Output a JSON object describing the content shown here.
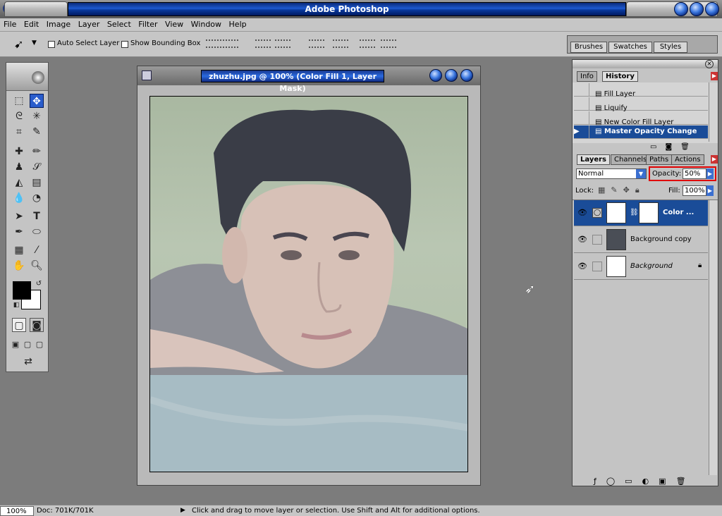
{
  "window": {
    "title": "Adobe Photoshop"
  },
  "menu": [
    "File",
    "Edit",
    "Image",
    "Layer",
    "Select",
    "Filter",
    "View",
    "Window",
    "Help"
  ],
  "options": {
    "auto_select_layer": "Auto Select Layer",
    "show_bounding_box": "Show Bounding Box"
  },
  "palette_well": {
    "tabs": [
      "Brushes",
      "Swatches",
      "Styles"
    ]
  },
  "document": {
    "title": "zhuzhu.jpg @ 100% (Color Fill 1, Layer Mask)"
  },
  "history_panel": {
    "tabs": [
      "Info",
      "History"
    ],
    "items": [
      "Fill Layer",
      "Liquify",
      "New Color Fill Layer",
      "Master Opacity Change"
    ]
  },
  "layers_panel": {
    "tabs": [
      "Layers",
      "Channels",
      "Paths",
      "Actions"
    ],
    "blend_mode": "Normal",
    "opacity_label": "Opacity:",
    "opacity_value": "50%",
    "lock_label": "Lock:",
    "fill_label": "Fill:",
    "fill_value": "100%",
    "layers": [
      "Color ...",
      "Background copy",
      "Background"
    ]
  },
  "status": {
    "zoom": "100%",
    "doc_size": "Doc: 701K/701K",
    "hint": "Click and drag to move layer or selection.  Use Shift and Alt for additional options."
  },
  "colors": {
    "accent": "#1a4c98",
    "highlight_box": "#e00000"
  }
}
